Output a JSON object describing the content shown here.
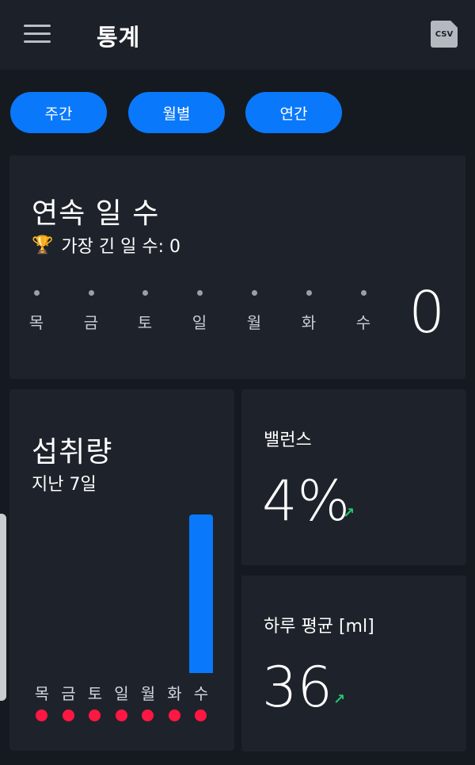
{
  "header": {
    "title": "통계",
    "csv_label": "CSV"
  },
  "tabs": [
    {
      "label": "주간"
    },
    {
      "label": "월별"
    },
    {
      "label": "연간"
    }
  ],
  "streak": {
    "title": "연속 일 수",
    "longest_label": "가장 긴 일 수: 0",
    "days": [
      "목",
      "금",
      "토",
      "일",
      "월",
      "화",
      "수"
    ],
    "count": "0"
  },
  "intake": {
    "title": "섭취량",
    "subtitle": "지난 7일",
    "days": [
      "목",
      "금",
      "토",
      "일",
      "월",
      "화",
      "수"
    ],
    "values": [
      0,
      0,
      0,
      0,
      0,
      0,
      250
    ],
    "max": 250
  },
  "balance": {
    "label": "밸런스",
    "value": "4%"
  },
  "daily_avg": {
    "label": "하루 평균 [ml]",
    "value": "36"
  },
  "colors": {
    "accent": "#0a78fa",
    "background": "#151a21",
    "card": "#1e232b",
    "trend_up": "#25c76c",
    "missed_dot": "#ff1744"
  },
  "icons": {
    "menu": "menu-icon",
    "csv": "csv-export-icon",
    "trophy": "trophy-icon",
    "trend": "trend-up-icon"
  }
}
